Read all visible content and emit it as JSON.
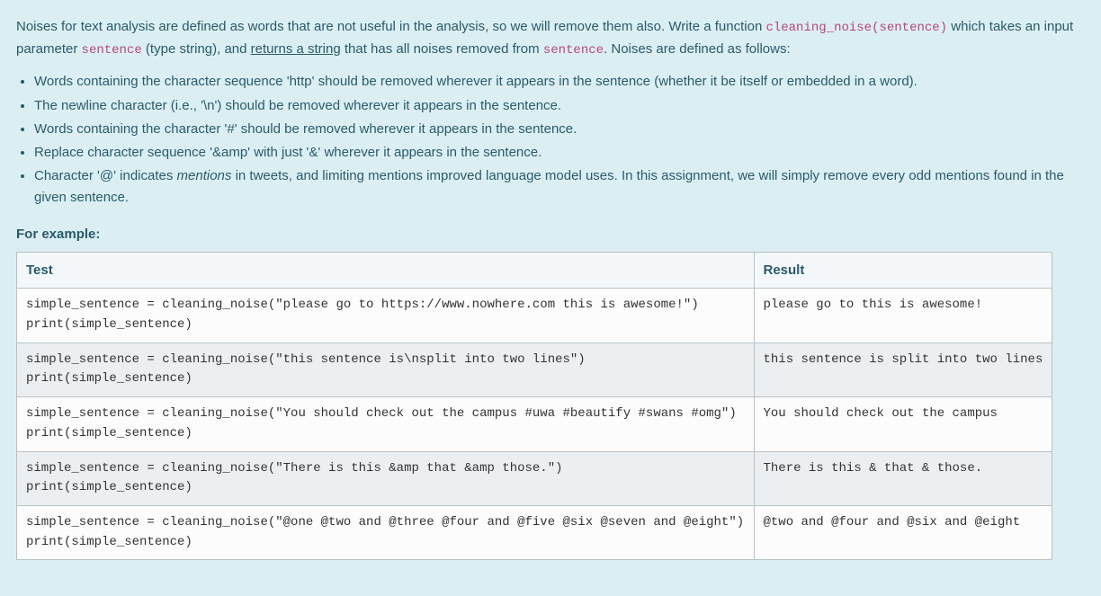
{
  "intro": {
    "seg1": "Noises for text analysis are defined as words that are not useful in the analysis, so we will remove them also. Write a function ",
    "fn": "cleaning_noise(sentence)",
    "seg2": " which takes an input parameter ",
    "param": "sentence",
    "seg3": " (type string), and ",
    "ret": "returns a string",
    "seg4": " that has all noises removed from ",
    "param2": "sentence",
    "seg5": ". Noises are defined as follows:"
  },
  "rules": {
    "r0": "Words containing the character sequence 'http' should be removed wherever it appears in the sentence (whether it be itself or embedded in a word).",
    "r1": "The newline character (i.e., '\\n') should be removed wherever it appears in the sentence.",
    "r2": "Words containing the character '#' should be removed wherever it appears in the sentence.",
    "r3": "Replace character sequence '&amp' with just '&' wherever it appears in the sentence.",
    "r4a": "Character '@' indicates ",
    "r4b": "mentions",
    "r4c": " in tweets, and limiting mentions improved language model uses. In this assignment, we will simply remove every odd mentions found in the given sentence."
  },
  "forExample": "For example:",
  "headers": {
    "test": "Test",
    "result": "Result"
  },
  "rows": [
    {
      "test": "simple_sentence = cleaning_noise(\"please go to https://www.nowhere.com this is awesome!\")\nprint(simple_sentence)",
      "result": "please go to this is awesome!"
    },
    {
      "test": "simple_sentence = cleaning_noise(\"this sentence is\\nsplit into two lines\")\nprint(simple_sentence)",
      "result": "this sentence is split into two lines"
    },
    {
      "test": "simple_sentence = cleaning_noise(\"You should check out the campus #uwa #beautify #swans #omg\")\nprint(simple_sentence)",
      "result": "You should check out the campus"
    },
    {
      "test": "simple_sentence = cleaning_noise(\"There is this &amp that &amp those.\")\nprint(simple_sentence)",
      "result": "There is this & that & those."
    },
    {
      "test": "simple_sentence = cleaning_noise(\"@one @two and @three @four and @five @six @seven and @eight\")\nprint(simple_sentence)",
      "result": "@two and @four and @six and @eight"
    }
  ]
}
